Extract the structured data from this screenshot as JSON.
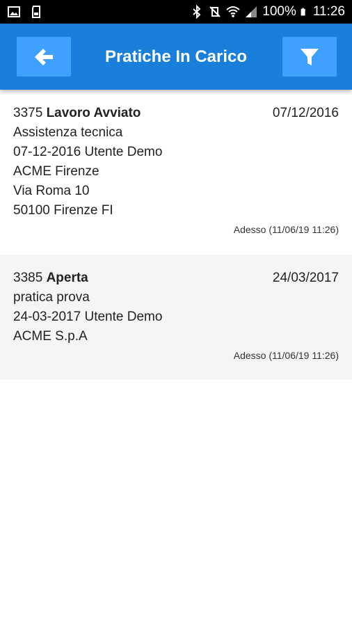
{
  "status_bar": {
    "battery": "100%",
    "time": "11:26"
  },
  "app_bar": {
    "title": "Pratiche In Carico",
    "back_icon": "arrow-left-icon",
    "filter_icon": "filter-icon",
    "accent": "#1a7fdb",
    "button_color": "#3fa0ff"
  },
  "items": [
    {
      "number": "3375",
      "status": "Lavoro Avviato",
      "date": "07/12/2016",
      "description": "Assistenza tecnica",
      "opened": "07-12-2016 Utente Demo",
      "company": "ACME Firenze",
      "address": "Via Roma 10",
      "city": "50100 Firenze FI",
      "updated": "Adesso (11/06/19 11:26)"
    },
    {
      "number": "3385",
      "status": "Aperta",
      "date": "24/03/2017",
      "description": "pratica prova",
      "opened": "24-03-2017 Utente Demo",
      "company": "ACME S.p.A",
      "updated": "Adesso (11/06/19 11:26)"
    }
  ]
}
